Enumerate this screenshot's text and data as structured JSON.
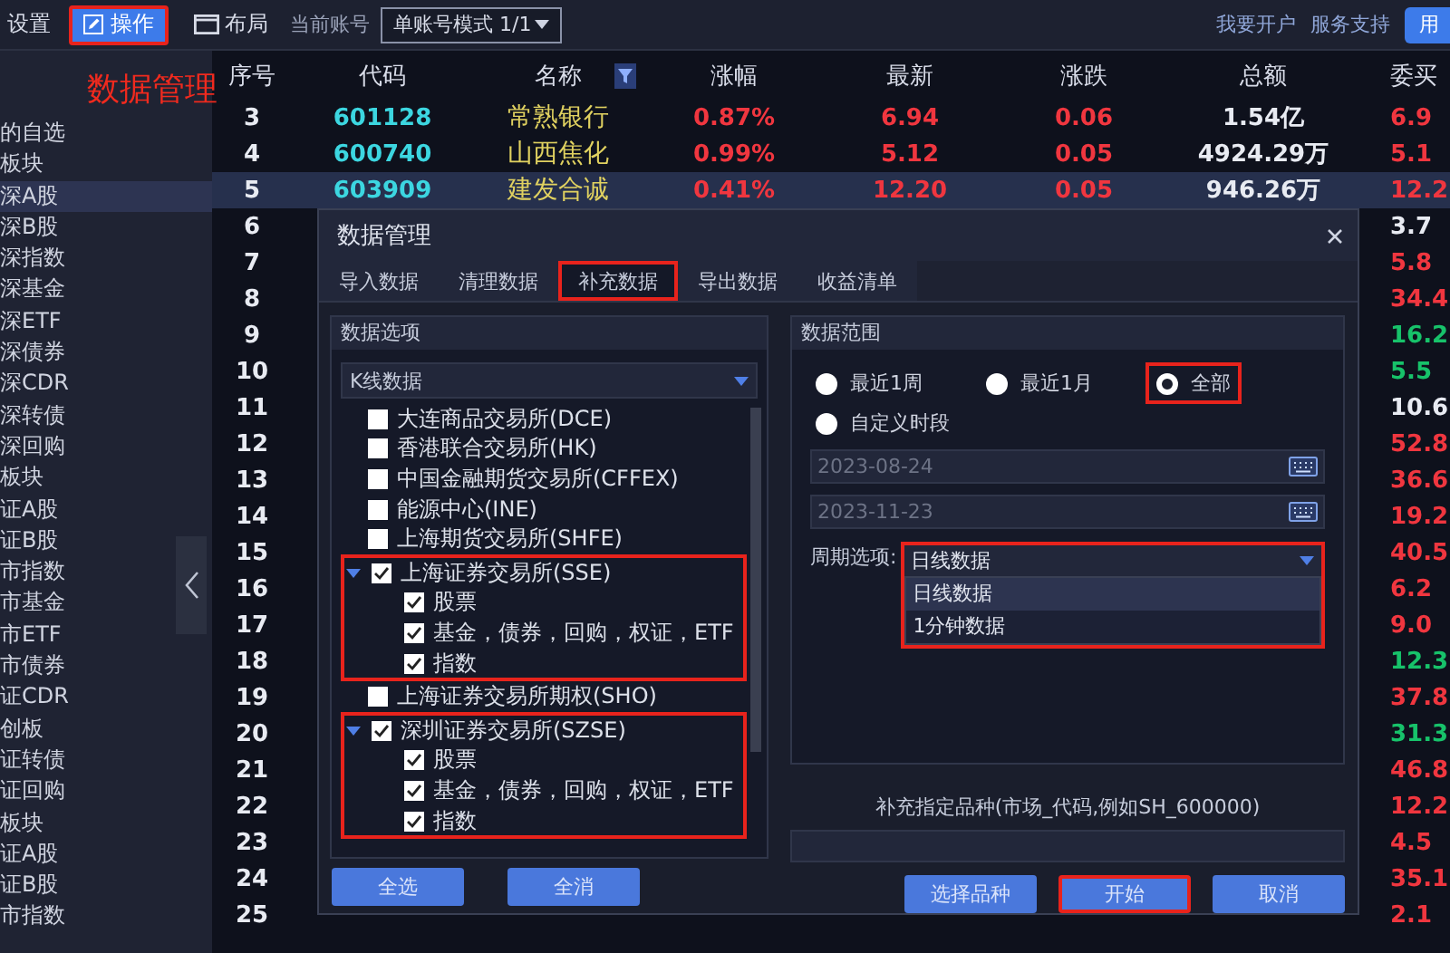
{
  "toolbar": {
    "settings": "设置",
    "operate": {
      "label": "操作",
      "highlighted": true
    },
    "layout": "布局",
    "account_label": "当前账号",
    "account_select": "单账号模式 1/1",
    "links": [
      "我要开户",
      "服务支持"
    ],
    "user_button": "用"
  },
  "annotation": "数据管理",
  "sidebar": {
    "items": [
      {
        "label": "的自选",
        "selected": false
      },
      {
        "label": "板块",
        "selected": false
      },
      {
        "label": "深A股",
        "selected": true
      },
      {
        "label": "深B股",
        "selected": false
      },
      {
        "label": "深指数",
        "selected": false
      },
      {
        "label": "深基金",
        "selected": false
      },
      {
        "label": "深ETF",
        "selected": false
      },
      {
        "label": "深债券",
        "selected": false
      },
      {
        "label": "深CDR",
        "selected": false
      },
      {
        "label": "深转债",
        "selected": false
      },
      {
        "label": "深回购",
        "selected": false
      },
      {
        "label": "板块",
        "selected": false
      },
      {
        "label": "证A股",
        "selected": false
      },
      {
        "label": "证B股",
        "selected": false
      },
      {
        "label": "市指数",
        "selected": false
      },
      {
        "label": "市基金",
        "selected": false
      },
      {
        "label": "市ETF",
        "selected": false
      },
      {
        "label": "市债券",
        "selected": false
      },
      {
        "label": "证CDR",
        "selected": false
      },
      {
        "label": "创板",
        "selected": false
      },
      {
        "label": "证转债",
        "selected": false
      },
      {
        "label": "证回购",
        "selected": false
      },
      {
        "label": "板块",
        "selected": false
      },
      {
        "label": "证A股",
        "selected": false
      },
      {
        "label": "证B股",
        "selected": false
      },
      {
        "label": "市指数",
        "selected": false
      }
    ]
  },
  "table": {
    "columns": [
      "序号",
      "代码",
      "名称",
      "涨幅",
      "最新",
      "涨跌",
      "总额",
      "委买"
    ],
    "rows": [
      {
        "seq": "3",
        "code": "601128",
        "name": "常熟银行",
        "change_pct": "0.87%",
        "last": "6.94",
        "change": "0.06",
        "amount": "1.54亿",
        "bid": "6.9",
        "color": "#f0363f",
        "selected": false
      },
      {
        "seq": "4",
        "code": "600740",
        "name": "山西焦化",
        "change_pct": "0.99%",
        "last": "5.12",
        "change": "0.05",
        "amount": "4924.29万",
        "bid": "5.1",
        "color": "#f0363f",
        "selected": false
      },
      {
        "seq": "5",
        "code": "603909",
        "name": "建发合诚",
        "change_pct": "0.41%",
        "last": "12.20",
        "change": "0.05",
        "amount": "946.26万",
        "bid": "12.2",
        "color": "#f0363f",
        "selected": true
      },
      {
        "seq": "6",
        "bid": "3.7",
        "color": "#e8ebf2",
        "selected": false
      },
      {
        "seq": "7",
        "bid": "5.8",
        "color": "#f0363f",
        "selected": false
      },
      {
        "seq": "8",
        "bid": "34.4",
        "color": "#f0363f",
        "selected": false
      },
      {
        "seq": "9",
        "bid": "16.2",
        "color": "#17c26a",
        "selected": false
      },
      {
        "seq": "10",
        "bid": "5.5",
        "color": "#17c26a",
        "selected": false
      },
      {
        "seq": "11",
        "bid": "10.6",
        "color": "#e8ebf2",
        "selected": false
      },
      {
        "seq": "12",
        "bid": "52.8",
        "color": "#f0363f",
        "selected": false
      },
      {
        "seq": "13",
        "bid": "36.6",
        "color": "#f0363f",
        "selected": false
      },
      {
        "seq": "14",
        "bid": "19.2",
        "color": "#f0363f",
        "selected": false
      },
      {
        "seq": "15",
        "bid": "40.5",
        "color": "#f0363f",
        "selected": false
      },
      {
        "seq": "16",
        "bid": "6.2",
        "color": "#f0363f",
        "selected": false
      },
      {
        "seq": "17",
        "bid": "9.0",
        "color": "#f0363f",
        "selected": false
      },
      {
        "seq": "18",
        "bid": "12.3",
        "color": "#17c26a",
        "selected": false
      },
      {
        "seq": "19",
        "bid": "37.8",
        "color": "#f0363f",
        "selected": false
      },
      {
        "seq": "20",
        "bid": "31.3",
        "color": "#17c26a",
        "selected": false
      },
      {
        "seq": "21",
        "bid": "46.8",
        "color": "#f0363f",
        "selected": false
      },
      {
        "seq": "22",
        "bid": "12.2",
        "color": "#f0363f",
        "selected": false
      },
      {
        "seq": "23",
        "bid": "4.5",
        "color": "#f0363f",
        "selected": false
      },
      {
        "seq": "24",
        "bid": "35.1",
        "color": "#f0363f",
        "selected": false
      },
      {
        "seq": "25",
        "bid": "2.1",
        "color": "#f0363f",
        "selected": false
      }
    ]
  },
  "dialog": {
    "title": "数据管理",
    "tabs": [
      {
        "label": "导入数据",
        "selected": false,
        "highlighted": false
      },
      {
        "label": "清理数据",
        "selected": false,
        "highlighted": false
      },
      {
        "label": "补充数据",
        "selected": true,
        "highlighted": true
      },
      {
        "label": "导出数据",
        "selected": false,
        "highlighted": false
      },
      {
        "label": "收益清单",
        "selected": false,
        "highlighted": false
      }
    ],
    "options": {
      "title": "数据选项",
      "data_type": "K线数据",
      "tree": [
        {
          "label": "大连商品交易所(DCE)",
          "checked": false
        },
        {
          "label": "香港联合交易所(HK)",
          "checked": false
        },
        {
          "label": "中国金融期货交易所(CFFEX)",
          "checked": false
        },
        {
          "label": "能源中心(INE)",
          "checked": false
        },
        {
          "label": "上海期货交易所(SHFE)",
          "checked": false
        },
        {
          "label": "上海证券交易所(SSE)",
          "checked": true,
          "expanded": true,
          "highlighted": true,
          "children": [
            {
              "label": "股票",
              "checked": true
            },
            {
              "label": "基金，债券，回购，权证，ETF",
              "checked": true
            },
            {
              "label": "指数",
              "checked": true
            }
          ]
        },
        {
          "label": "上海证券交易所期权(SHO)",
          "checked": false
        },
        {
          "label": "深圳证券交易所(SZSE)",
          "checked": true,
          "expanded": true,
          "highlighted": true,
          "children": [
            {
              "label": "股票",
              "checked": true
            },
            {
              "label": "基金，债券，回购，权证，ETF",
              "checked": true
            },
            {
              "label": "指数",
              "checked": true
            }
          ]
        }
      ],
      "buttons": [
        "全选",
        "全消"
      ]
    },
    "range": {
      "title": "数据范围",
      "radios": [
        {
          "label": "最近1周",
          "selected": false,
          "highlighted": false
        },
        {
          "label": "最近1月",
          "selected": false,
          "highlighted": false
        },
        {
          "label": "全部",
          "selected": true,
          "highlighted": true
        },
        {
          "label": "自定义时段",
          "selected": false,
          "highlighted": false
        }
      ],
      "start_date": {
        "value": "2023-08-24",
        "disabled": true
      },
      "end_date": {
        "value": "2023-11-23",
        "disabled": true
      },
      "period": {
        "label": "周期选项:",
        "value": "日线数据",
        "highlighted": true,
        "options": [
          {
            "label": "日线数据",
            "selected": true
          },
          {
            "label": "1分钟数据",
            "selected": false
          }
        ]
      }
    },
    "symbol_label": "补充指定品种(市场_代码,例如SH_600000)",
    "buttons": [
      {
        "label": "选择品种",
        "highlighted": false
      },
      {
        "label": "开始",
        "highlighted": true
      },
      {
        "label": "取消",
        "highlighted": false
      }
    ]
  }
}
